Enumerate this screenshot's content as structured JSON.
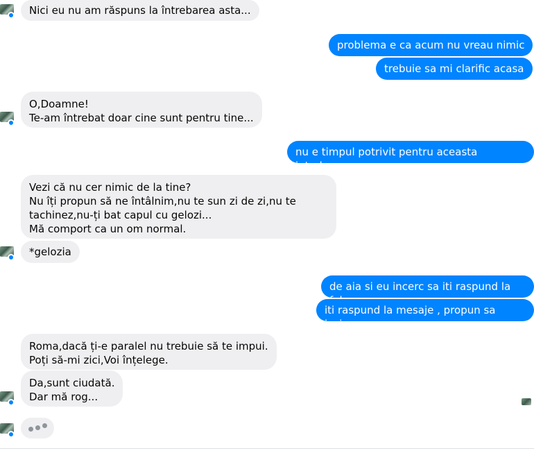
{
  "messages": [
    {
      "direction": "in",
      "lines": [
        "Nici eu nu am răspuns la întrebarea asta..."
      ]
    },
    {
      "direction": "out",
      "lines": [
        "problema e ca acum nu vreau nimic"
      ]
    },
    {
      "direction": "out",
      "lines": [
        "trebuie sa mi clarific acasa"
      ]
    },
    {
      "direction": "in",
      "lines": [
        "O,Doamne!",
        "Te-am întrebat doar cine sunt pentru tine..."
      ]
    },
    {
      "direction": "out",
      "lines": [
        "nu e timpul potrivit pentru aceasta intrebare"
      ]
    },
    {
      "direction": "in",
      "lines": [
        "Vezi că nu cer nimic de la tine?",
        "Nu îți propun să ne întâlnim,nu te sun zi de zi,nu te",
        "tachinez,nu-ți bat capul cu gelozi...",
        "Mă comport ca un om normal."
      ]
    },
    {
      "direction": "in",
      "lines": [
        "*gelozia"
      ]
    },
    {
      "direction": "out",
      "lines": [
        "de aia si eu incerc sa iti raspund la fel"
      ]
    },
    {
      "direction": "out",
      "lines": [
        "iti raspund la mesaje , propun sa iesim"
      ]
    },
    {
      "direction": "in",
      "lines": [
        "Roma,dacă ți-e paralel nu trebuie să te impui.",
        "Poți să-mi zici,Voi înțelege."
      ]
    },
    {
      "direction": "in",
      "lines": [
        "Da,sunt ciudată.",
        "Dar mă rog..."
      ]
    }
  ],
  "icons": {
    "avatar": "contact-avatar-icon",
    "messenger_badge": "messenger-badge-icon",
    "seen": "seen-avatar-icon",
    "typing": "typing-indicator-icon"
  },
  "colors": {
    "outgoing_bubble": "#0084ff",
    "incoming_bubble": "#efeff1",
    "badge": "#0084ff"
  }
}
